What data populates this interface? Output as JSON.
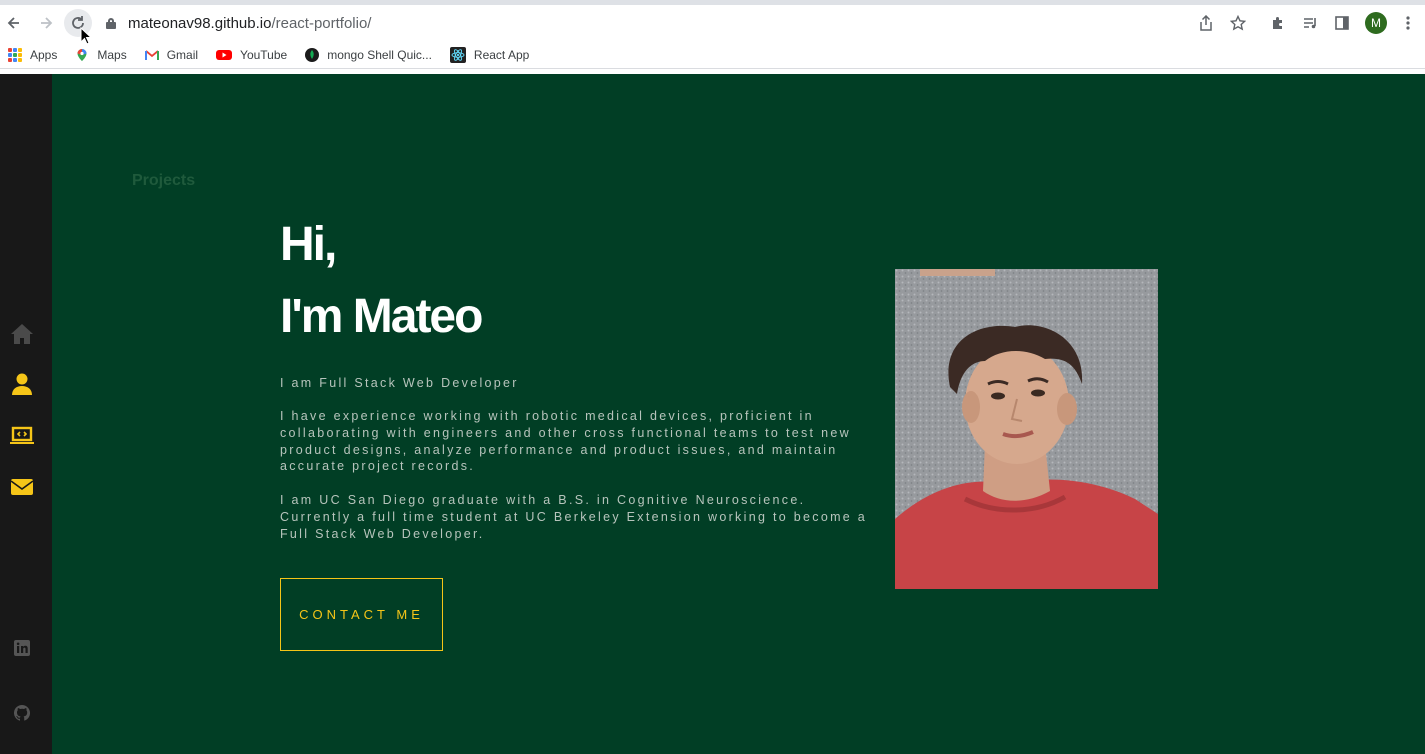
{
  "browser": {
    "url_host": "mateonav98.github.io",
    "url_path": "/react-portfolio/",
    "profile_initial": "M",
    "bookmarks": [
      {
        "label": "Apps",
        "icon": "apps-grid-icon"
      },
      {
        "label": "Maps",
        "icon": "maps-icon"
      },
      {
        "label": "Gmail",
        "icon": "gmail-icon"
      },
      {
        "label": "YouTube",
        "icon": "youtube-icon"
      },
      {
        "label": "mongo Shell Quic...",
        "icon": "mongodb-icon"
      },
      {
        "label": "React App",
        "icon": "react-icon"
      }
    ]
  },
  "sidebar": {
    "items": [
      {
        "name": "home",
        "icon": "home-icon",
        "color": "#4a4a4a"
      },
      {
        "name": "about",
        "icon": "user-icon",
        "color": "#f5c518"
      },
      {
        "name": "projects",
        "icon": "laptop-code-icon",
        "color": "#f5c518"
      },
      {
        "name": "contact",
        "icon": "envelope-icon",
        "color": "#f5c518"
      }
    ],
    "social": [
      {
        "name": "linkedin",
        "icon": "linkedin-icon"
      },
      {
        "name": "github",
        "icon": "github-icon"
      }
    ]
  },
  "main": {
    "faint_link": "Projects",
    "title_line1": "Hi,",
    "title_line2": "I'm Mateo",
    "role": "I am Full Stack Web Developer",
    "paragraph1": "I have experience working with robotic medical devices, proficient in collaborating with engineers and other cross functional teams to test new product designs, analyze performance and product issues, and maintain accurate project records.",
    "paragraph2": "I am UC San Diego graduate with a B.S. in Cognitive Neuroscience. Currently a full time student at UC Berkeley Extension working to become a Full Stack Web Developer.",
    "contact_label": "CONTACT ME"
  },
  "colors": {
    "background": "#013e25",
    "sidebar": "#181818",
    "accent": "#f5c518"
  }
}
